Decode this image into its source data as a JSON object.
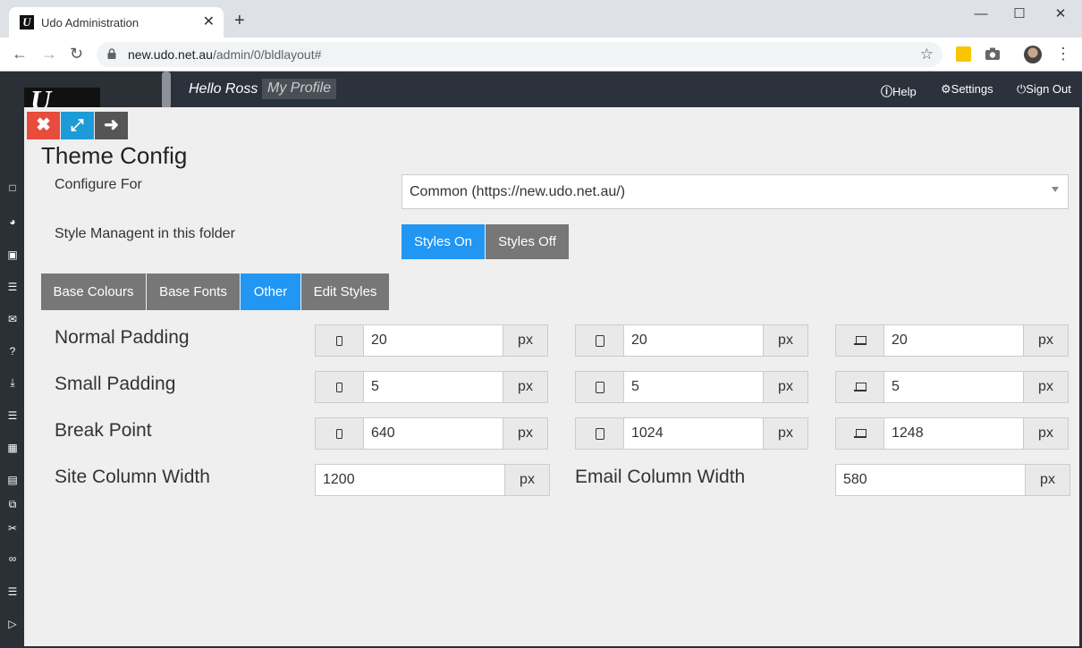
{
  "browser": {
    "tab_title": "Udo Administration",
    "tab_favicon": "U",
    "tab_close": "✕",
    "new_tab": "+",
    "url_host": "new.udo.net.au",
    "url_path": "/admin/0/bldlayout#",
    "icons": [
      "back-arrow-icon",
      "forward-arrow-icon",
      "reload-icon",
      "lock-icon",
      "star-icon",
      "extension-icon",
      "camera-icon",
      "avatar",
      "menu-dots-icon"
    ]
  },
  "header": {
    "greeting": "Hello Ross",
    "profile": "My Profile",
    "help": "Help",
    "settings": "Settings",
    "sign_out": "Sign Out"
  },
  "modal": {
    "title": "Theme Config",
    "configure_for_label": "Configure For",
    "configure_for_value": "Common (https://new.udo.net.au/)",
    "style_mgmt_label": "Style Managent in this folder",
    "styles_on": "Styles On",
    "styles_off": "Styles Off",
    "tabs": [
      "Base Colours",
      "Base Fonts",
      "Other",
      "Edit Styles"
    ],
    "active_tab": "Other",
    "unit": "px",
    "rows": [
      {
        "label": "Normal Padding",
        "mobile": "20",
        "tablet": "20",
        "desktop": "20"
      },
      {
        "label": "Small Padding",
        "mobile": "5",
        "tablet": "5",
        "desktop": "5"
      },
      {
        "label": "Break Point",
        "mobile": "640",
        "tablet": "1024",
        "desktop": "1248"
      }
    ],
    "site_column_label": "Site Column Width",
    "site_column_value": "1200",
    "email_column_label": "Email Column Width",
    "email_column_value": "580"
  },
  "colors": {
    "close": "#e74c3c",
    "expand": "#1e9bd7",
    "next": "#555555",
    "active": "#2196f3",
    "inactive": "#777777"
  }
}
